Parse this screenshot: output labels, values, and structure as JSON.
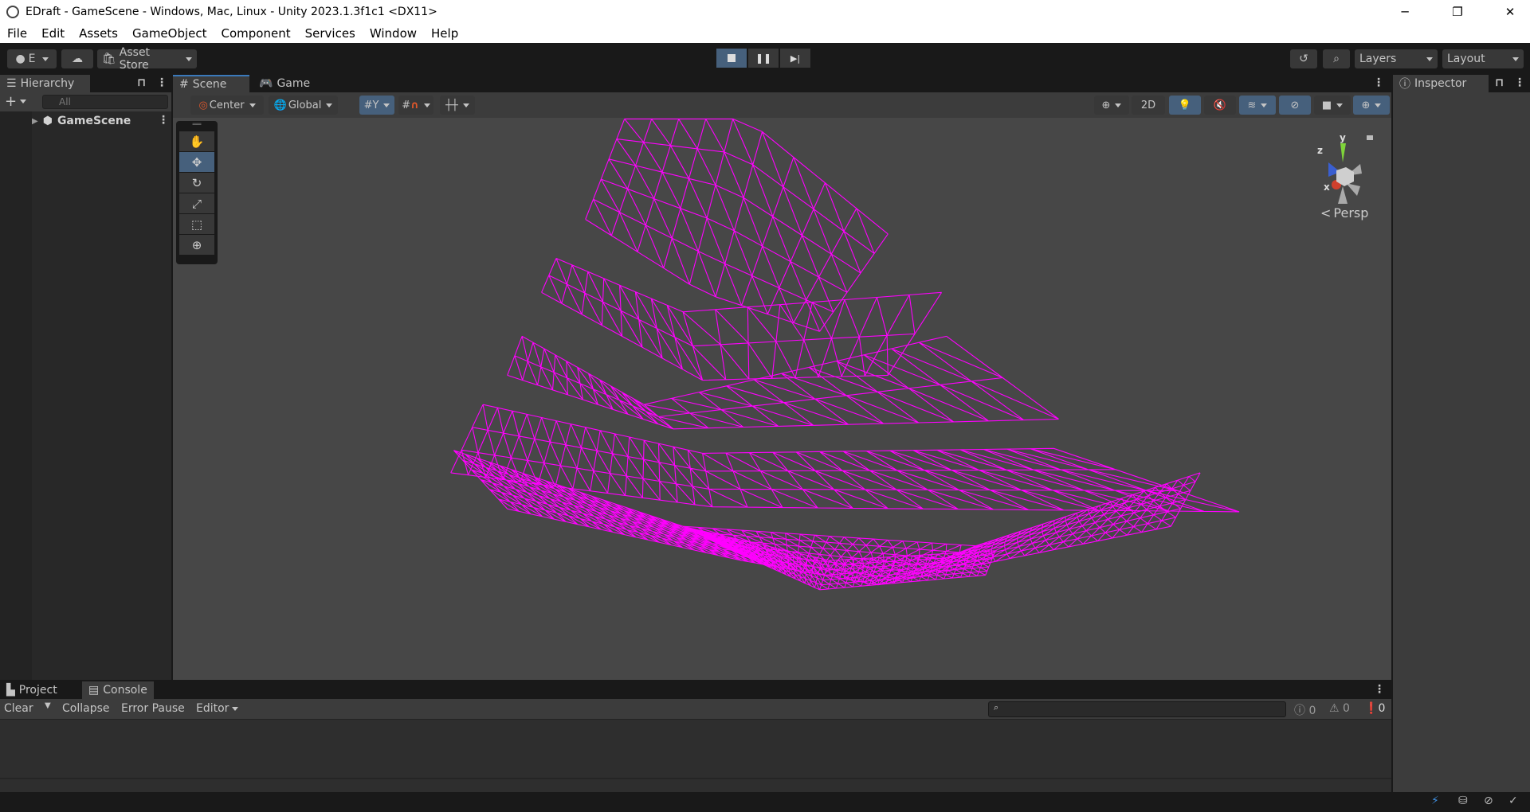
{
  "window": {
    "title": "EDraft - GameScene - Windows, Mac, Linux - Unity 2023.1.3f1c1 <DX11>",
    "minimize": "─",
    "restore": "❐",
    "close": "✕"
  },
  "menu": [
    "File",
    "Edit",
    "Assets",
    "GameObject",
    "Component",
    "Services",
    "Window",
    "Help"
  ],
  "toolbar": {
    "account": "E",
    "asset_store": "Asset Store",
    "layers": "Layers",
    "layout": "Layout"
  },
  "hierarchy": {
    "title": "Hierarchy",
    "search_placeholder": "All",
    "items": [
      {
        "label": "GameScene"
      }
    ]
  },
  "scene": {
    "tabs": [
      "Scene",
      "Game"
    ],
    "pivot": "Center",
    "space": "Global",
    "mode_2d": "2D",
    "projection": "Persp",
    "gizmo_axes": {
      "x": "x",
      "y": "y",
      "z": "z"
    },
    "wire_color": "#ff00ff"
  },
  "inspector": {
    "title": "Inspector"
  },
  "console": {
    "tabs": [
      "Project",
      "Console"
    ],
    "clear": "Clear",
    "collapse": "Collapse",
    "error_pause": "Error Pause",
    "editor": "Editor",
    "counts": {
      "info": "0",
      "warnings": "0",
      "errors": "0"
    }
  }
}
